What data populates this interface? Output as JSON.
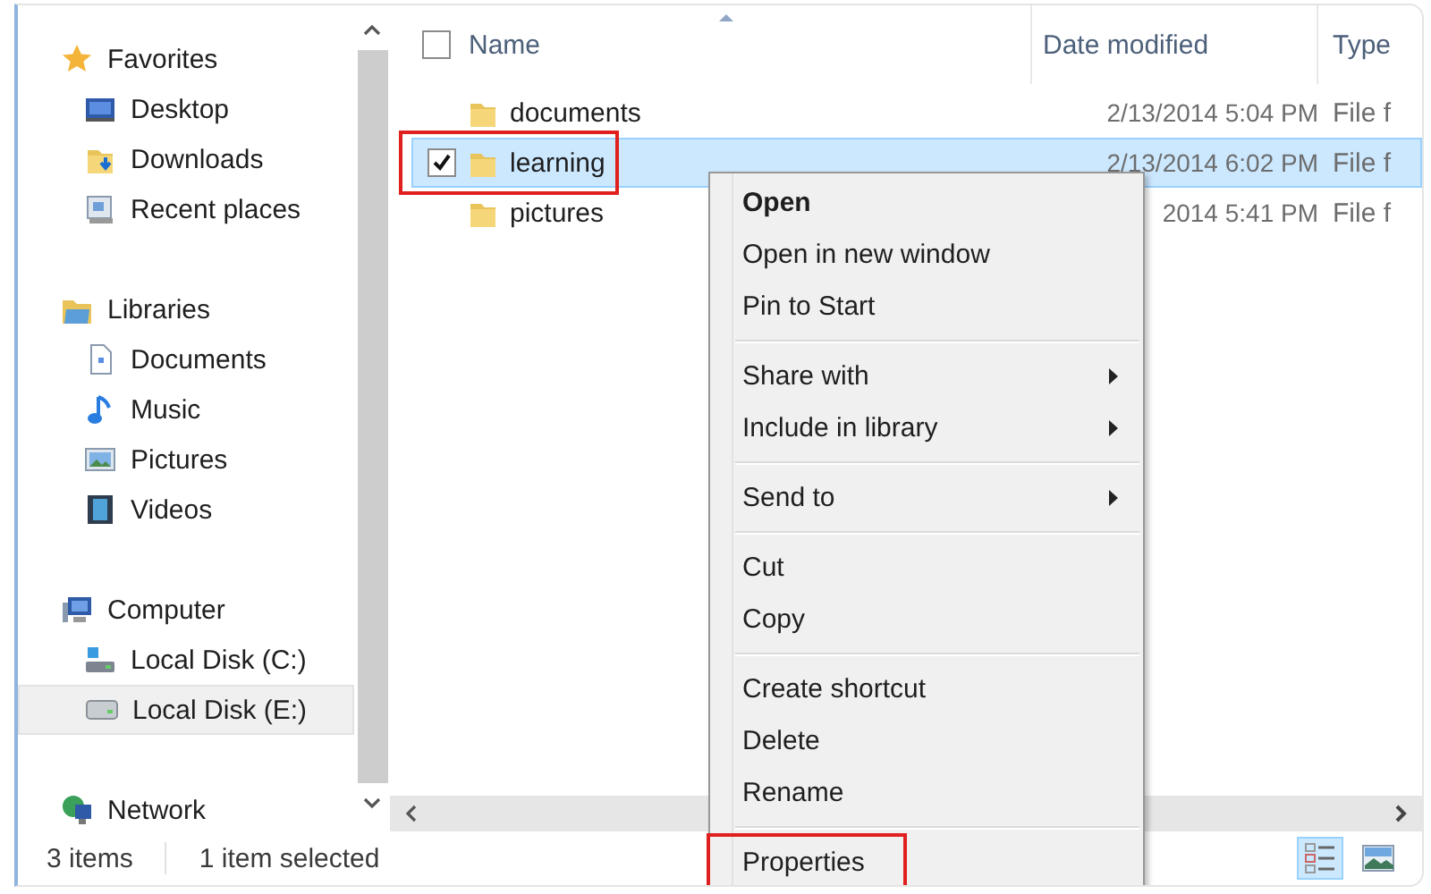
{
  "nav": [
    {
      "label": "Favorites",
      "selected": false,
      "children": [
        {
          "label": "Desktop",
          "selected": false
        },
        {
          "label": "Downloads",
          "selected": false
        },
        {
          "label": "Recent places",
          "selected": false
        }
      ]
    },
    {
      "label": "Libraries",
      "selected": false,
      "children": [
        {
          "label": "Documents",
          "selected": false
        },
        {
          "label": "Music",
          "selected": false
        },
        {
          "label": "Pictures",
          "selected": false
        },
        {
          "label": "Videos",
          "selected": false
        }
      ]
    },
    {
      "label": "Computer",
      "selected": false,
      "children": [
        {
          "label": "Local Disk (C:)",
          "selected": false
        },
        {
          "label": "Local Disk (E:)",
          "selected": true
        }
      ]
    },
    {
      "label": "Network",
      "selected": false
    }
  ],
  "list": {
    "columns": [
      "Name",
      "Date modified",
      "Type"
    ],
    "all_checked": false,
    "rows": [
      {
        "name": "documents",
        "date": "2/13/2014 5:04 PM",
        "type": "File f",
        "selected": false,
        "checked": false,
        "highlighted": false
      },
      {
        "name": "learning",
        "date": "2/13/2014 6:02 PM",
        "type": "File f",
        "selected": true,
        "checked": true,
        "highlighted": true
      },
      {
        "name": "pictures",
        "date": "2014 5:41 PM",
        "type": "File f",
        "selected": false,
        "checked": false,
        "highlighted": false
      }
    ]
  },
  "context_menu": [
    {
      "kind": "item",
      "label": "Open",
      "default": true,
      "submenu": false,
      "highlighted": false
    },
    {
      "kind": "item",
      "label": "Open in new window",
      "default": false,
      "submenu": false,
      "highlighted": false
    },
    {
      "kind": "item",
      "label": "Pin to Start",
      "default": false,
      "submenu": false,
      "highlighted": false
    },
    {
      "kind": "separator"
    },
    {
      "kind": "item",
      "label": "Share with",
      "default": false,
      "submenu": true,
      "highlighted": false
    },
    {
      "kind": "item",
      "label": "Include in library",
      "default": false,
      "submenu": true,
      "highlighted": false
    },
    {
      "kind": "separator"
    },
    {
      "kind": "item",
      "label": "Send to",
      "default": false,
      "submenu": true,
      "highlighted": false
    },
    {
      "kind": "separator"
    },
    {
      "kind": "item",
      "label": "Cut",
      "default": false,
      "submenu": false,
      "highlighted": false
    },
    {
      "kind": "item",
      "label": "Copy",
      "default": false,
      "submenu": false,
      "highlighted": false
    },
    {
      "kind": "separator"
    },
    {
      "kind": "item",
      "label": "Create shortcut",
      "default": false,
      "submenu": false,
      "highlighted": false
    },
    {
      "kind": "item",
      "label": "Delete",
      "default": false,
      "submenu": false,
      "highlighted": false
    },
    {
      "kind": "item",
      "label": "Rename",
      "default": false,
      "submenu": false,
      "highlighted": false
    },
    {
      "kind": "separator"
    },
    {
      "kind": "item",
      "label": "Properties",
      "default": false,
      "submenu": false,
      "highlighted": true
    }
  ],
  "status_bar": {
    "item_count": "3 items",
    "selection": "1 item selected",
    "views": [
      {
        "selected": true
      },
      {
        "selected": false
      }
    ]
  }
}
